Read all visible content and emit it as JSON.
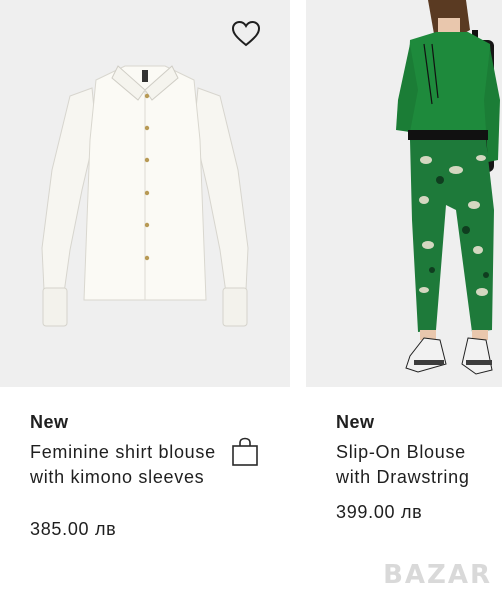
{
  "products": [
    {
      "badge": "New",
      "title": "Feminine shirt blouse with kimono sleeves",
      "price": "385.00 лв",
      "image_description": "white-shirt-blouse"
    },
    {
      "badge": "New",
      "title_line1": "Slip-On Blouse",
      "title_line2": "with Drawstring",
      "price": "399.00 лв",
      "image_description": "green-blouse-model"
    }
  ],
  "icons": {
    "wishlist": "heart-icon",
    "add_to_bag": "shopping-bag-icon"
  },
  "watermark": "BAZAR",
  "colors": {
    "image_bg": "#efefef",
    "text": "#1f1f1f",
    "blouse_green": "#1e8a3c"
  }
}
